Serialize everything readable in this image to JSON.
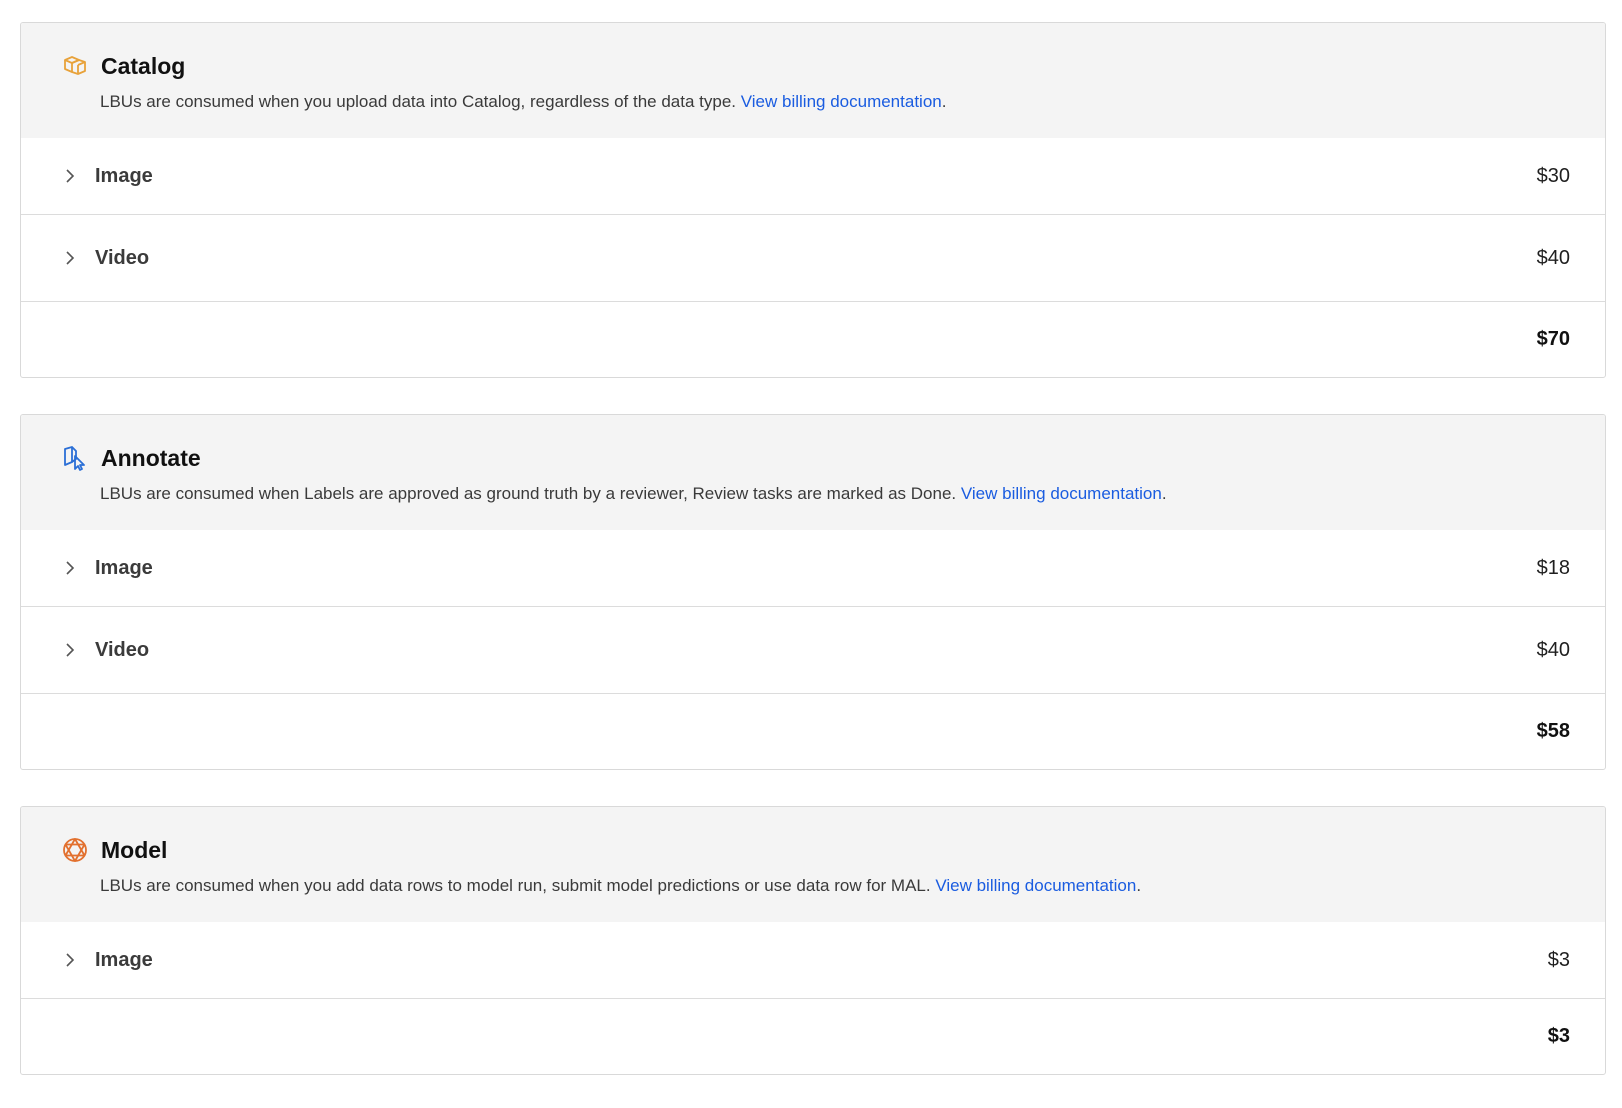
{
  "sections": [
    {
      "key": "catalog",
      "icon": "catalog-icon",
      "icon_color": "#e8a23a",
      "title": "Catalog",
      "description": "LBUs are consumed when you upload data into Catalog, regardless of the data type.",
      "link_text": "View billing documentation",
      "rows": [
        {
          "label": "Image",
          "amount": "$30"
        },
        {
          "label": "Video",
          "amount": "$40"
        }
      ],
      "total": "$70"
    },
    {
      "key": "annotate",
      "icon": "annotate-icon",
      "icon_color": "#2b6fd6",
      "title": "Annotate",
      "description": "LBUs are consumed when Labels are approved as ground truth by a reviewer, Review tasks are marked as Done.",
      "link_text": "View billing documentation",
      "rows": [
        {
          "label": "Image",
          "amount": "$18"
        },
        {
          "label": "Video",
          "amount": "$40"
        }
      ],
      "total": "$58"
    },
    {
      "key": "model",
      "icon": "model-icon",
      "icon_color": "#e2702e",
      "title": "Model",
      "description": "LBUs are consumed when you add data rows to model run, submit model predictions or use data row for MAL.",
      "link_text": "View billing documentation",
      "rows": [
        {
          "label": "Image",
          "amount": "$3"
        }
      ],
      "total": "$3"
    }
  ],
  "link_color": "#1a5ce0"
}
